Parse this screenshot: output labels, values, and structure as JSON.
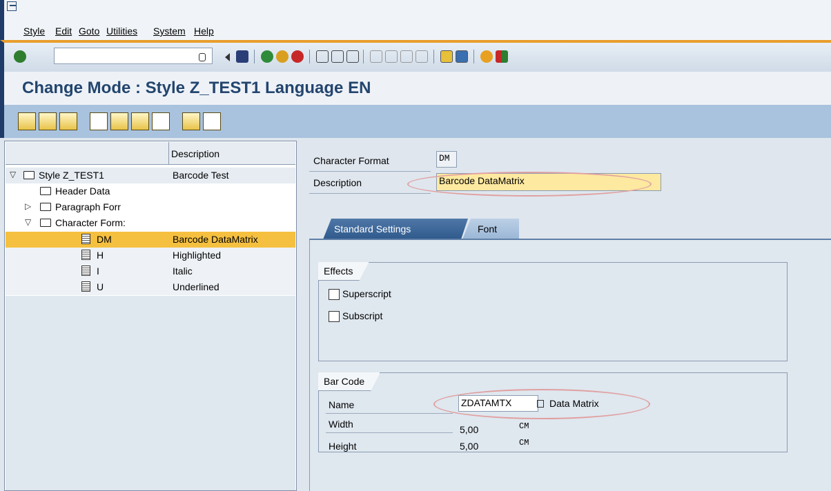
{
  "menu": [
    "Style",
    "Edit",
    "Goto",
    "Utilities",
    "System",
    "Help"
  ],
  "title": "Change Mode : Style Z_TEST1 Language EN",
  "tree": {
    "header_desc": "Description",
    "rows": [
      {
        "name": "Style Z_TEST1",
        "desc": "Barcode Test"
      },
      {
        "name": "Header Data",
        "desc": ""
      },
      {
        "name": "Paragraph Forr",
        "desc": ""
      },
      {
        "name": "Character Form:",
        "desc": ""
      },
      {
        "name": "DM",
        "desc": "Barcode DataMatrix"
      },
      {
        "name": "H",
        "desc": "Highlighted"
      },
      {
        "name": "I",
        "desc": "Italic"
      },
      {
        "name": "U",
        "desc": "Underlined"
      }
    ]
  },
  "form": {
    "char_format_label": "Character Format",
    "char_format_value": "DM",
    "description_label": "Description",
    "description_value": "Barcode DataMatrix"
  },
  "tabs": [
    "Standard Settings",
    "Font"
  ],
  "effects": {
    "title": "Effects",
    "superscript": "Superscript",
    "subscript": "Subscript"
  },
  "barcode": {
    "title": "Bar Code",
    "name_label": "Name",
    "name_value": "ZDATAMTX",
    "name_desc": "Data Matrix",
    "width_label": "Width",
    "width_value": "5,00",
    "width_unit": "CM",
    "height_label": "Height",
    "height_value": "5,00",
    "height_unit": "CM"
  }
}
